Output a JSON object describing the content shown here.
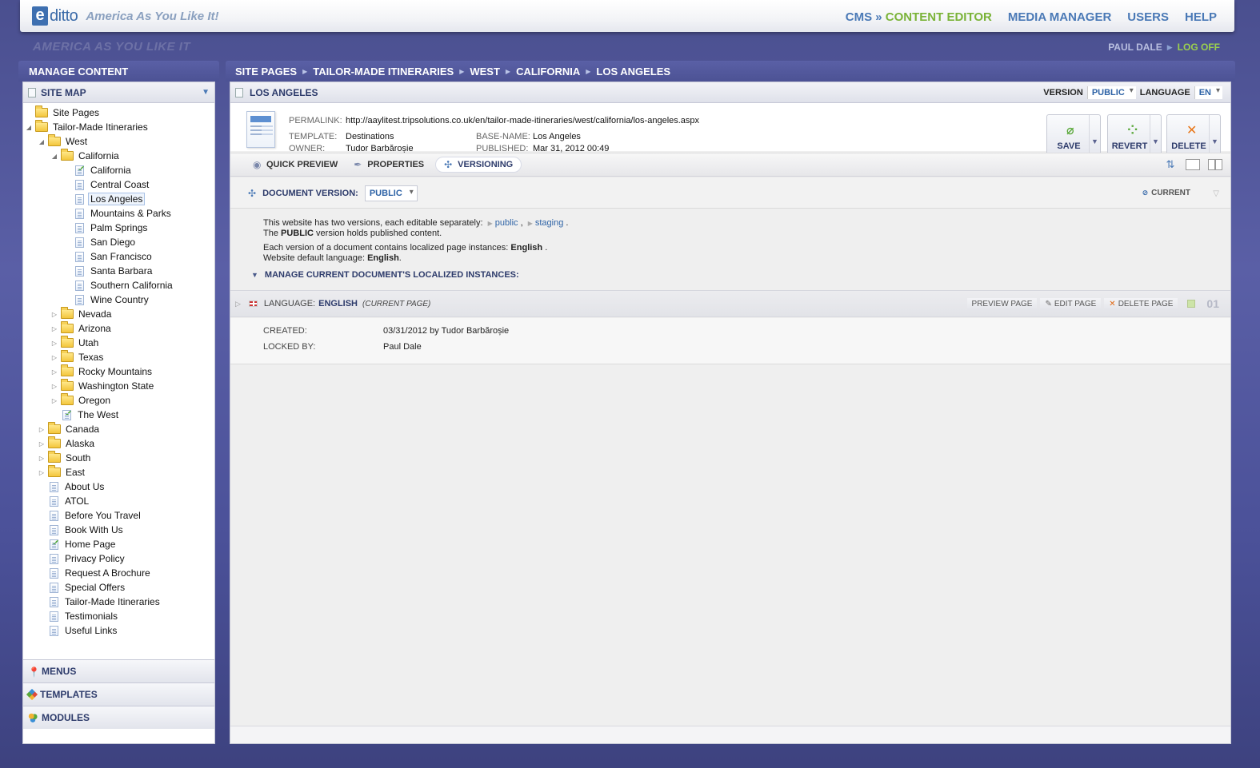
{
  "brand": {
    "logo_letter": "e",
    "logo_word": "ditto",
    "tagline": "America As You Like It!"
  },
  "top_nav": {
    "cms_prefix": "CMS »",
    "cms_active": "CONTENT EDITOR",
    "media_manager": "MEDIA MANAGER",
    "users": "USERS",
    "help": "HELP"
  },
  "watermark": "AMERICA AS YOU LIKE IT",
  "user": {
    "name": "PAUL DALE",
    "log_off": "LOG OFF"
  },
  "left_panel": {
    "title": "MANAGE CONTENT",
    "sitemap_title": "SITE MAP",
    "tree": [
      {
        "label": "Site Pages",
        "level": 0,
        "type": "folder",
        "toggle": ""
      },
      {
        "label": "Tailor-Made Itineraries",
        "level": 0,
        "type": "folder",
        "toggle": "◢"
      },
      {
        "label": "West",
        "level": 1,
        "type": "folder",
        "toggle": "◢"
      },
      {
        "label": "California",
        "level": 2,
        "type": "folder",
        "toggle": "◢"
      },
      {
        "label": "California",
        "level": 3,
        "type": "page-check",
        "toggle": ""
      },
      {
        "label": "Central Coast",
        "level": 3,
        "type": "page",
        "toggle": ""
      },
      {
        "label": "Los Angeles",
        "level": 3,
        "type": "page",
        "toggle": "",
        "selected": true
      },
      {
        "label": "Mountains & Parks",
        "level": 3,
        "type": "page",
        "toggle": ""
      },
      {
        "label": "Palm Springs",
        "level": 3,
        "type": "page",
        "toggle": ""
      },
      {
        "label": "San Diego",
        "level": 3,
        "type": "page",
        "toggle": ""
      },
      {
        "label": "San Francisco",
        "level": 3,
        "type": "page",
        "toggle": ""
      },
      {
        "label": "Santa Barbara",
        "level": 3,
        "type": "page",
        "toggle": ""
      },
      {
        "label": "Southern California",
        "level": 3,
        "type": "page",
        "toggle": ""
      },
      {
        "label": "Wine Country",
        "level": 3,
        "type": "page",
        "toggle": ""
      },
      {
        "label": "Nevada",
        "level": 2,
        "type": "folder",
        "toggle": "▷"
      },
      {
        "label": "Arizona",
        "level": 2,
        "type": "folder",
        "toggle": "▷"
      },
      {
        "label": "Utah",
        "level": 2,
        "type": "folder",
        "toggle": "▷"
      },
      {
        "label": "Texas",
        "level": 2,
        "type": "folder",
        "toggle": "▷"
      },
      {
        "label": "Rocky Mountains",
        "level": 2,
        "type": "folder",
        "toggle": "▷"
      },
      {
        "label": "Washington State",
        "level": 2,
        "type": "folder",
        "toggle": "▷"
      },
      {
        "label": "Oregon",
        "level": 2,
        "type": "folder",
        "toggle": "▷"
      },
      {
        "label": "The West",
        "level": 2,
        "type": "page-check",
        "toggle": ""
      },
      {
        "label": "Canada",
        "level": 1,
        "type": "folder",
        "toggle": "▷"
      },
      {
        "label": "Alaska",
        "level": 1,
        "type": "folder",
        "toggle": "▷"
      },
      {
        "label": "South",
        "level": 1,
        "type": "folder",
        "toggle": "▷"
      },
      {
        "label": "East",
        "level": 1,
        "type": "folder",
        "toggle": "▷"
      },
      {
        "label": "About Us",
        "level": 1,
        "type": "page",
        "toggle": ""
      },
      {
        "label": "ATOL",
        "level": 1,
        "type": "page",
        "toggle": ""
      },
      {
        "label": "Before You Travel",
        "level": 1,
        "type": "page",
        "toggle": ""
      },
      {
        "label": "Book With Us",
        "level": 1,
        "type": "page",
        "toggle": ""
      },
      {
        "label": "Home Page",
        "level": 1,
        "type": "page-check",
        "toggle": ""
      },
      {
        "label": "Privacy Policy",
        "level": 1,
        "type": "page",
        "toggle": ""
      },
      {
        "label": "Request A Brochure",
        "level": 1,
        "type": "page",
        "toggle": ""
      },
      {
        "label": "Special Offers",
        "level": 1,
        "type": "page",
        "toggle": ""
      },
      {
        "label": "Tailor-Made Itineraries",
        "level": 1,
        "type": "page",
        "toggle": ""
      },
      {
        "label": "Testimonials",
        "level": 1,
        "type": "page",
        "toggle": ""
      },
      {
        "label": "Useful Links",
        "level": 1,
        "type": "page",
        "toggle": ""
      }
    ],
    "accordions": {
      "menus": "MENUS",
      "templates": "TEMPLATES",
      "modules": "MODULES"
    }
  },
  "breadcrumb": [
    "SITE PAGES",
    "TAILOR-MADE ITINERARIES",
    "WEST",
    "CALIFORNIA",
    "LOS ANGELES"
  ],
  "document": {
    "title": "LOS ANGELES",
    "version_label": "VERSION",
    "version_value": "PUBLIC",
    "language_label": "LANGUAGE",
    "language_value": "EN",
    "permalink_label": "PERMALINK:",
    "permalink": "http://aaylitest.tripsolutions.co.uk/en/tailor-made-itineraries/west/california/los-angeles.aspx",
    "template_label": "TEMPLATE:",
    "template": "Destinations",
    "owner_label": "OWNER:",
    "owner": "Tudor Barbăroșie",
    "basename_label": "BASE-NAME:",
    "basename": "Los Angeles",
    "published_label": "PUBLISHED:",
    "published": "Mar 31, 2012 00:49",
    "buttons": {
      "save": "SAVE",
      "revert": "REVERT",
      "delete": "DELETE"
    },
    "colors": {
      "save": "#5aa83a",
      "revert": "#5aa83a",
      "delete": "#e8771a"
    }
  },
  "tabs": {
    "quick_preview": "QUICK PREVIEW",
    "properties": "PROPERTIES",
    "versioning": "VERSIONING"
  },
  "versioning": {
    "doc_version_label": "DOCUMENT VERSION:",
    "doc_version_value": "PUBLIC",
    "current": "CURRENT",
    "line1_pre": "This website has two versions, each editable separately:",
    "link_public": "public",
    "comma": ",",
    "link_staging": "staging",
    "period": ".",
    "line2_pre": "The",
    "line2_bold": "PUBLIC",
    "line2_post": "version holds published content.",
    "line3_pre": "Each version of a document contains localized page instances:",
    "line3_bold": "English",
    "line3_post": ".",
    "line4_pre": "Website default language:",
    "line4_bold": "English",
    "line4_post": ".",
    "manage_instances": "MANAGE CURRENT DOCUMENT'S LOCALIZED INSTANCES:"
  },
  "instance": {
    "language_label": "LANGUAGE:",
    "language_value": "ENGLISH",
    "current_page": "(CURRENT PAGE)",
    "preview_page": "PREVIEW PAGE",
    "edit_page": "EDIT PAGE",
    "delete_page": "DELETE PAGE",
    "number": "01",
    "created_label": "CREATED:",
    "created_value": "03/31/2012 by Tudor Barbăroșie",
    "locked_label": "LOCKED BY:",
    "locked_value": "Paul Dale"
  }
}
